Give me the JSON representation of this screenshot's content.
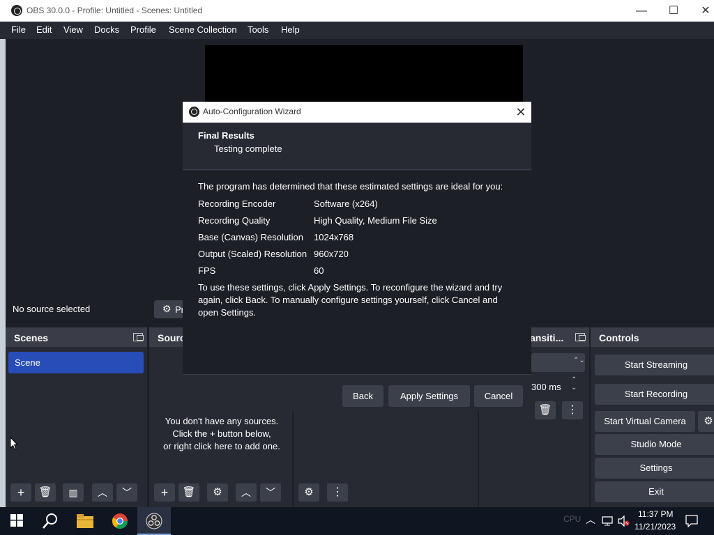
{
  "window": {
    "title": "OBS 30.0.0 - Profile: Untitled - Scenes: Untitled",
    "minimize": "—",
    "maximize": "☐",
    "close": "✕"
  },
  "menu": [
    "File",
    "Edit",
    "View",
    "Docks",
    "Profile",
    "Scene Collection",
    "Tools",
    "Help"
  ],
  "source_bar": {
    "no_source": "No source selected",
    "properties_label": "Pr"
  },
  "docks": {
    "scenes": {
      "title": "Scenes",
      "items": [
        "Scene"
      ]
    },
    "sources": {
      "title": "Sourc",
      "empty_line1": "You don't have any sources.",
      "empty_line2": "Click the + button below,",
      "empty_line3": "or right click here to add one."
    },
    "transitions": {
      "title": "ansiti...",
      "duration": "300 ms"
    },
    "controls": {
      "title": "Controls",
      "buttons": [
        "Start Streaming",
        "Start Recording",
        "Start Virtual Camera",
        "Studio Mode",
        "Settings",
        "Exit"
      ]
    }
  },
  "dialog": {
    "title": "Auto-Configuration Wizard",
    "close": "✕",
    "header_title": "Final Results",
    "header_sub": "Testing complete",
    "intro": "The program has determined that these estimated settings are ideal for you:",
    "settings": [
      {
        "label": "Recording Encoder",
        "value": "Software (x264)"
      },
      {
        "label": "Recording Quality",
        "value": "High Quality, Medium File Size"
      },
      {
        "label": "Base (Canvas) Resolution",
        "value": "1024x768"
      },
      {
        "label": "Output (Scaled) Resolution",
        "value": "960x720"
      },
      {
        "label": "FPS",
        "value": "60"
      }
    ],
    "note": "To use these settings, click Apply Settings. To reconfigure the wizard and try again, click Back. To manually configure settings yourself, click Cancel and open Settings.",
    "buttons": {
      "back": "Back",
      "apply": "Apply Settings",
      "cancel": "Cancel"
    }
  },
  "taskbar": {
    "time": "11:37 PM",
    "date": "11/21/2023",
    "cpu_label": "CPU"
  },
  "colors": {
    "accent": "#284cb8",
    "panel": "#272a33",
    "background": "#1d1f26",
    "button": "#3c404b"
  }
}
